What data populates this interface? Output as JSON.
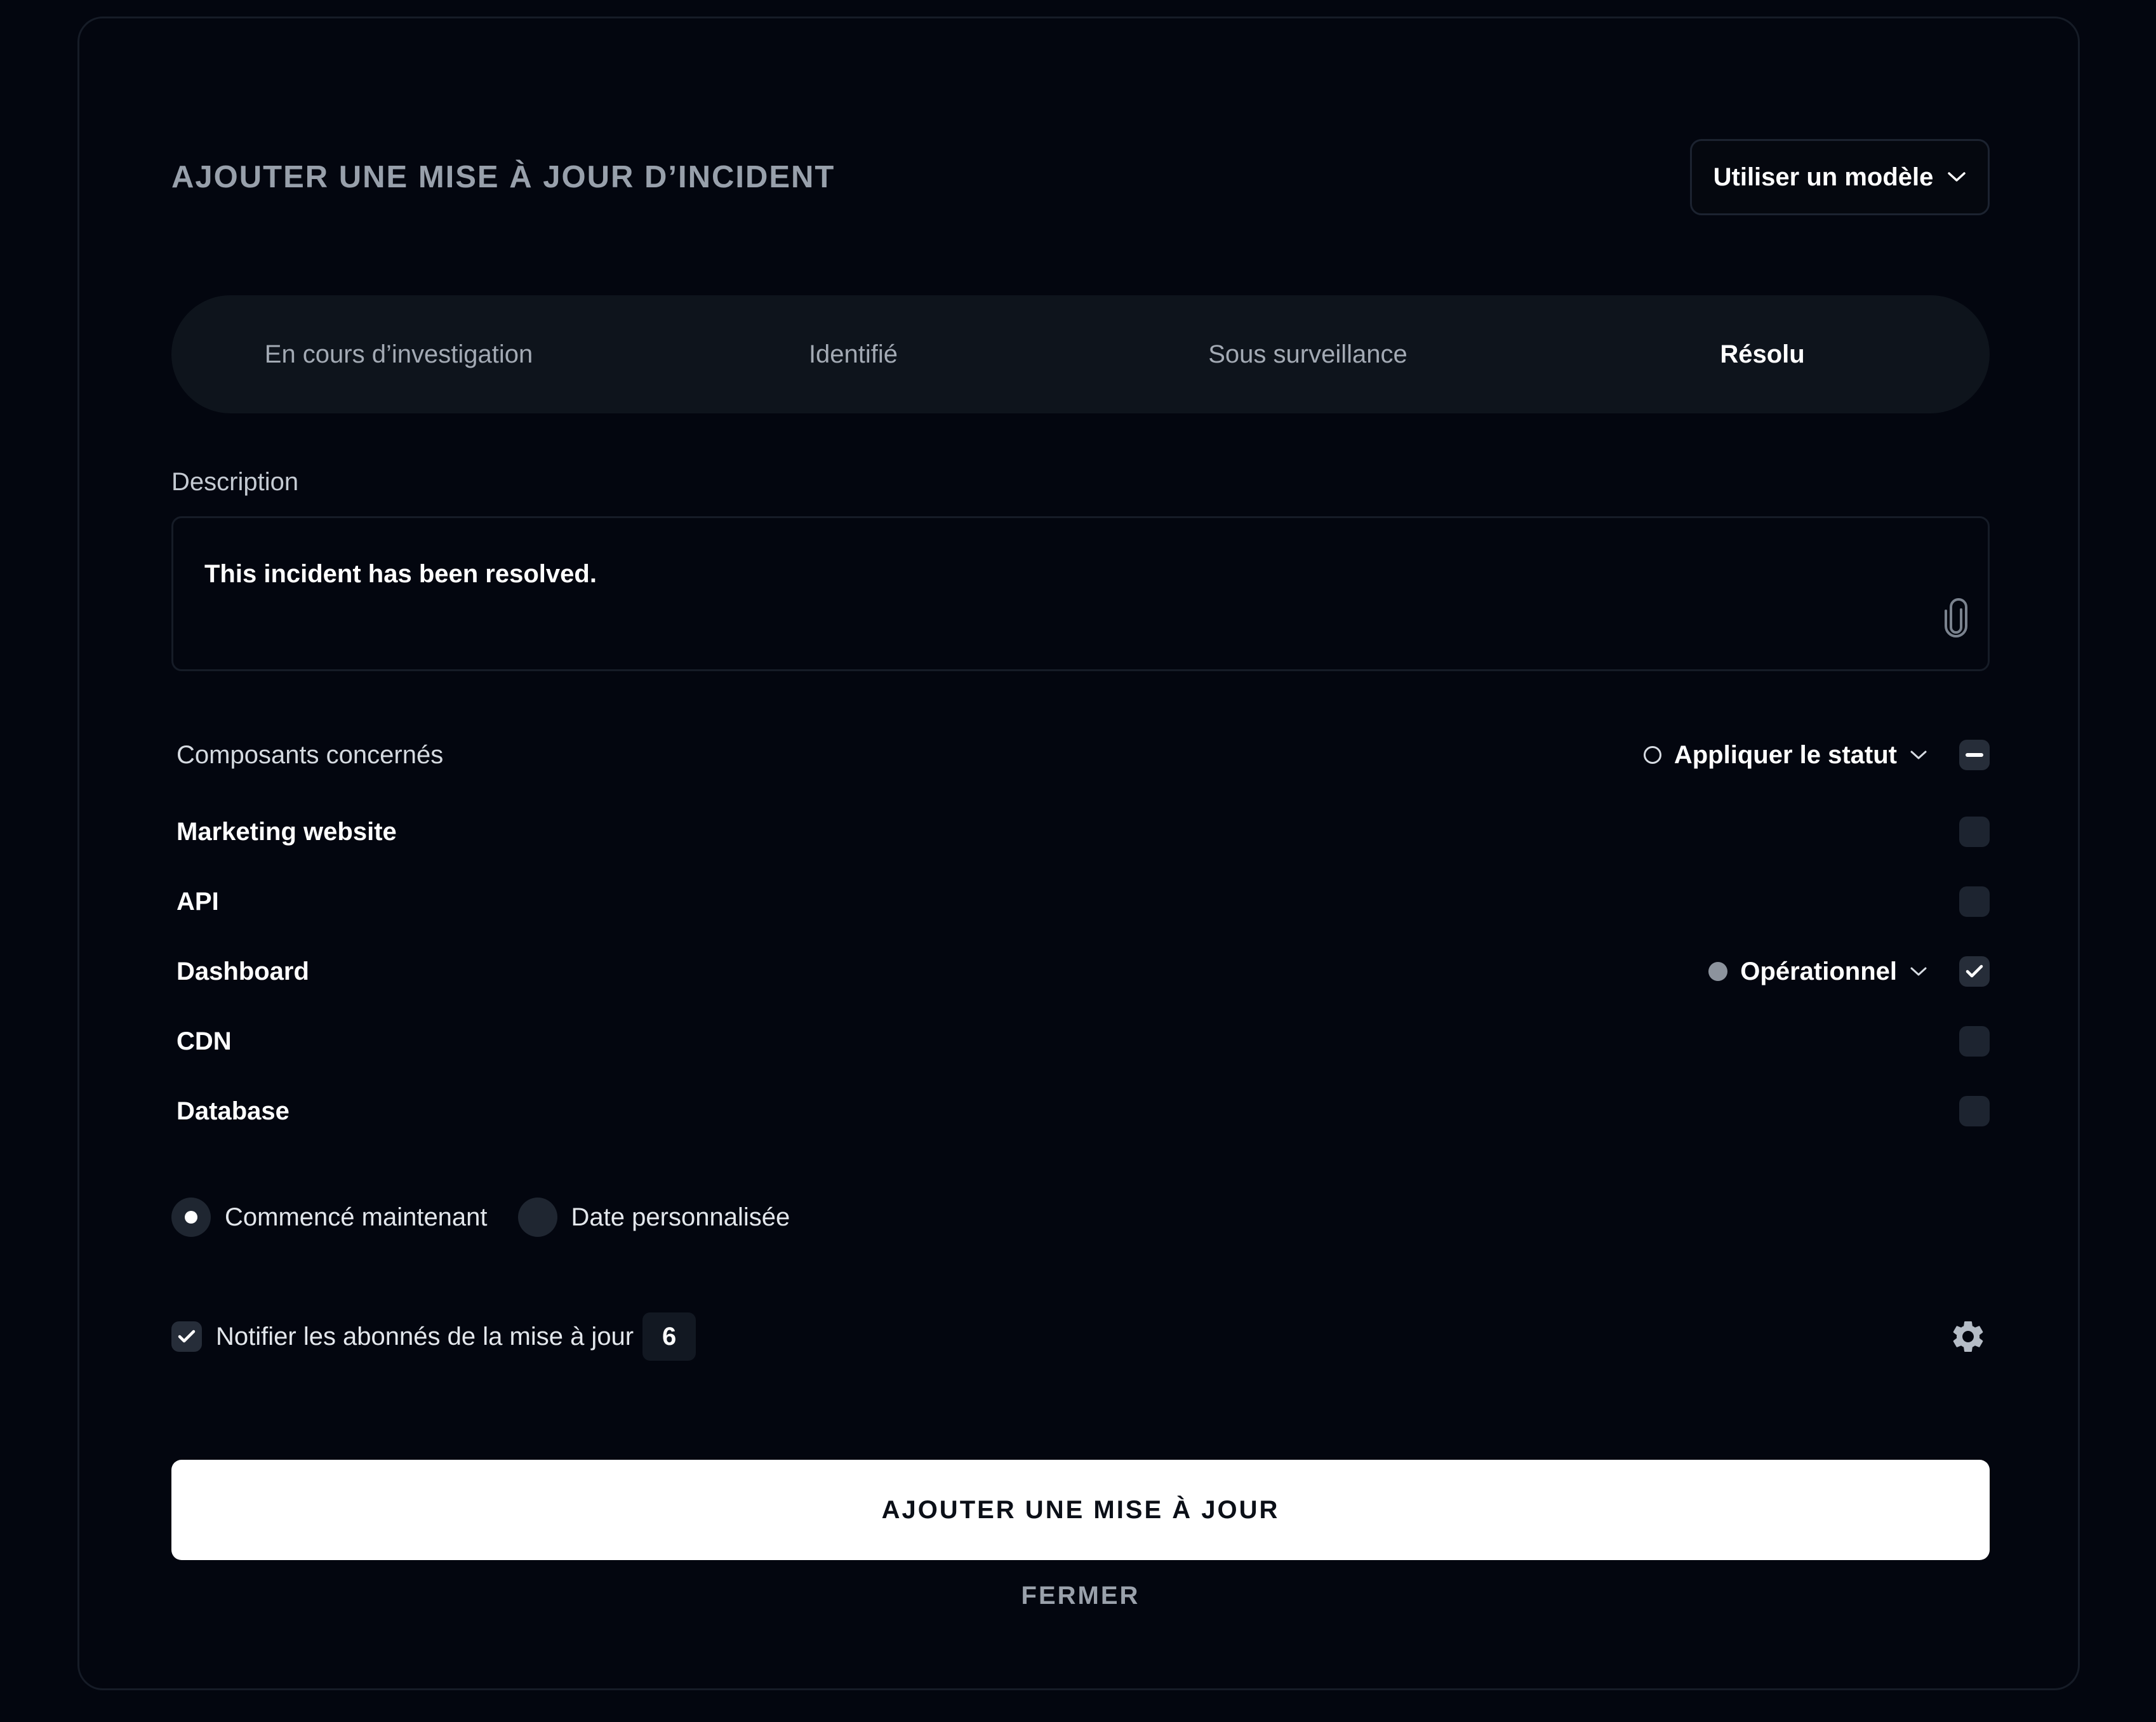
{
  "header": {
    "title": "AJOUTER UNE MISE À JOUR D’INCIDENT",
    "template_button_label": "Utiliser un modèle"
  },
  "tabs": [
    {
      "label": "En cours d’investigation",
      "active": false
    },
    {
      "label": "Identifié",
      "active": false
    },
    {
      "label": "Sous surveillance",
      "active": false
    },
    {
      "label": "Résolu",
      "active": true
    }
  ],
  "description": {
    "label": "Description",
    "value": "This incident has been resolved."
  },
  "components": {
    "title": "Composants concernés",
    "apply_status_label": "Appliquer le statut",
    "items": [
      {
        "name": "Marketing website",
        "checked": false,
        "status": ""
      },
      {
        "name": "API",
        "checked": false,
        "status": ""
      },
      {
        "name": "Dashboard",
        "checked": true,
        "status": "Opérationnel"
      },
      {
        "name": "CDN",
        "checked": false,
        "status": ""
      },
      {
        "name": "Database",
        "checked": false,
        "status": ""
      }
    ]
  },
  "start": {
    "options": [
      {
        "label": "Commencé maintenant",
        "selected": true
      },
      {
        "label": "Date personnalisée",
        "selected": false
      }
    ]
  },
  "notify": {
    "label": "Notifier les abonnés de la mise à jour",
    "count": "6",
    "checked": true
  },
  "actions": {
    "submit_label": "AJOUTER UNE MISE À JOUR",
    "close_label": "FERMER"
  },
  "colors": {
    "background": "#03060f",
    "card_border": "#161c27",
    "tab_bar": "#0e141c",
    "checkbox": "#1d2430",
    "operational_dot": "#8c939d",
    "primary_button": "#ffffff"
  },
  "icons": {
    "template_chevron": "chevron-down-icon",
    "attachment": "paperclip-icon",
    "settings": "gear-icon",
    "check": "check-icon",
    "indeterminate": "minus-icon"
  }
}
